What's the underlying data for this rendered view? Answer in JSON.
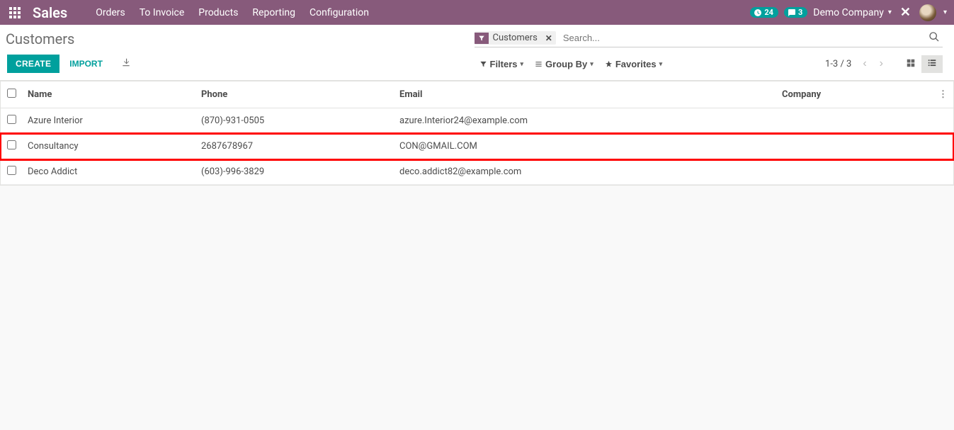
{
  "topbar": {
    "brand": "Sales",
    "nav": [
      "Orders",
      "To Invoice",
      "Products",
      "Reporting",
      "Configuration"
    ],
    "activity_count": "24",
    "messages_count": "3",
    "company": "Demo Company"
  },
  "breadcrumb": {
    "title": "Customers"
  },
  "search": {
    "facet_label": "Customers",
    "placeholder": "Search..."
  },
  "buttons": {
    "create": "CREATE",
    "import": "IMPORT",
    "filters": "Filters",
    "group_by": "Group By",
    "favorites": "Favorites"
  },
  "pager": {
    "text": "1-3 / 3"
  },
  "table": {
    "headers": {
      "name": "Name",
      "phone": "Phone",
      "email": "Email",
      "company": "Company"
    },
    "rows": [
      {
        "name": "Azure Interior",
        "phone": "(870)-931-0505",
        "email": "azure.Interior24@example.com",
        "company": "",
        "highlight": false
      },
      {
        "name": "Consultancy",
        "phone": "2687678967",
        "email": "CON@GMAIL.COM",
        "company": "",
        "highlight": true
      },
      {
        "name": "Deco Addict",
        "phone": "(603)-996-3829",
        "email": "deco.addict82@example.com",
        "company": "",
        "highlight": false
      }
    ]
  }
}
